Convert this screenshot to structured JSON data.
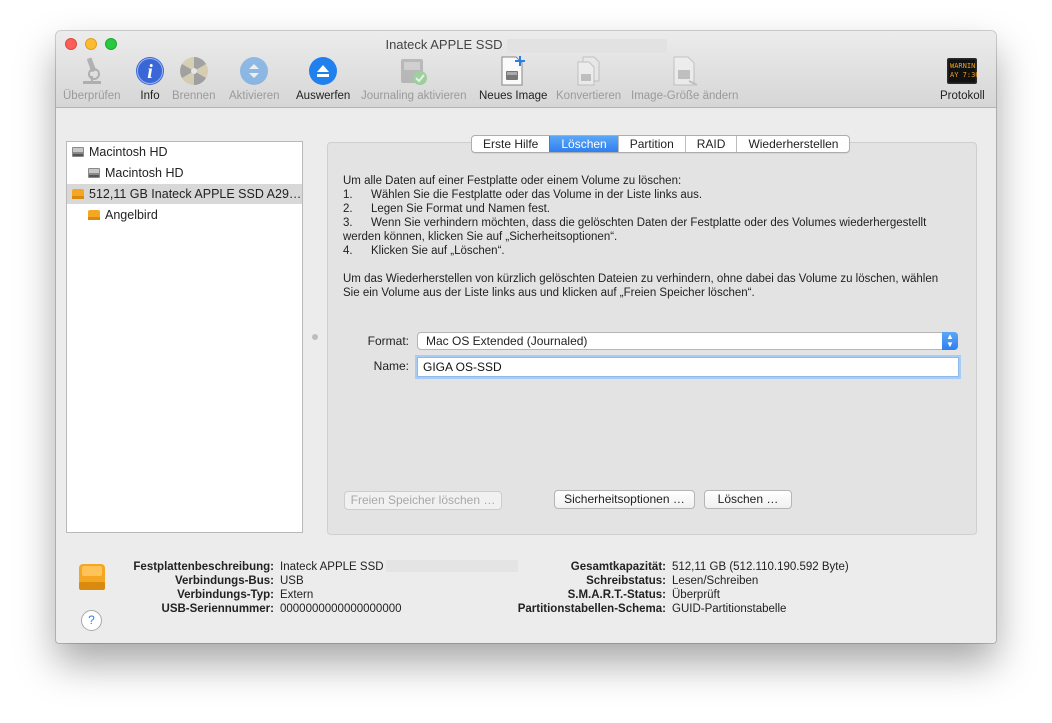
{
  "window": {
    "title": "Inateck APPLE SSD"
  },
  "toolbar": {
    "items": [
      {
        "label": "Überprüfen",
        "icon": "microscope-icon",
        "enabled": false
      },
      {
        "label": "Info",
        "icon": "info-icon",
        "enabled": true
      },
      {
        "label": "Brennen",
        "icon": "burn-disc-icon",
        "enabled": false
      },
      {
        "label": "Aktivieren",
        "icon": "mount-icon",
        "enabled": false
      },
      {
        "label": "Auswerfen",
        "icon": "eject-icon",
        "enabled": true
      },
      {
        "label": "Journaling aktivieren",
        "icon": "journaling-icon",
        "enabled": false
      },
      {
        "label": "Neues Image",
        "icon": "new-image-icon",
        "enabled": true
      },
      {
        "label": "Konvertieren",
        "icon": "convert-icon",
        "enabled": false
      },
      {
        "label": "Image-Größe ändern",
        "icon": "resize-image-icon",
        "enabled": false
      },
      {
        "label": "Protokoll",
        "icon": "log-console-icon",
        "enabled": true
      }
    ],
    "log_icon_text": "WARNIN\nAY 7:36"
  },
  "sidebar": {
    "items": [
      {
        "label": "Macintosh HD",
        "level": 0,
        "icon": "internal-disk-icon"
      },
      {
        "label": "Macintosh HD",
        "level": 1,
        "icon": "internal-disk-icon"
      },
      {
        "label": "512,11 GB Inateck APPLE SSD A29…",
        "level": 0,
        "icon": "external-disk-icon",
        "selected": true
      },
      {
        "label": "Angelbird",
        "level": 1,
        "icon": "external-disk-icon"
      }
    ]
  },
  "tabs": [
    "Erste Hilfe",
    "Löschen",
    "Partition",
    "RAID",
    "Wiederherstellen"
  ],
  "active_tab": "Löschen",
  "erase": {
    "intro": "Um alle Daten auf einer Festplatte oder einem Volume zu löschen:",
    "steps": [
      {
        "num": "1.",
        "text": "Wählen Sie die Festplatte oder das Volume in der Liste links aus."
      },
      {
        "num": "2.",
        "text": "Legen Sie Format und Namen fest."
      },
      {
        "num": "3.",
        "text": "Wenn Sie verhindern möchten, dass die gelöschten Daten der Festplatte oder des Volumes wiederhergestellt",
        "cont": "werden können, klicken Sie auf „Sicherheitsoptionen“."
      },
      {
        "num": "4.",
        "text": "Klicken Sie auf „Löschen“."
      }
    ],
    "para2_line1": "Um das Wiederherstellen von kürzlich gelöschten Dateien zu verhindern, ohne dabei das Volume zu löschen, wählen",
    "para2_line2": "Sie ein Volume aus der Liste links aus und klicken auf „Freien Speicher löschen“.",
    "format_label": "Format:",
    "format_value": "Mac OS Extended (Journaled)",
    "name_label": "Name:",
    "name_value": "GIGA OS-SSD",
    "free_space_button": "Freien Speicher löschen …",
    "security_button": "Sicherheitsoptionen …",
    "erase_button": "Löschen …"
  },
  "info": {
    "left": [
      {
        "key": "Festplattenbeschreibung",
        "value": "Inateck APPLE SSD"
      },
      {
        "key": "Verbindungs-Bus",
        "value": "USB"
      },
      {
        "key": "Verbindungs-Typ",
        "value": "Extern"
      },
      {
        "key": "USB-Seriennummer",
        "value": "0000000000000000000"
      }
    ],
    "right": [
      {
        "key": "Gesamtkapazität",
        "value": "512,11 GB (512.110.190.592 Byte)"
      },
      {
        "key": "Schreibstatus",
        "value": "Lesen/Schreiben"
      },
      {
        "key": "S.M.A.R.T.-Status",
        "value": "Überprüft"
      },
      {
        "key": "Partitionstabellen-Schema",
        "value": "GUID-Partitionstabelle"
      }
    ],
    "help_label": "?"
  },
  "colors": {
    "accent": "#2f7ff0",
    "disk_orange": "#f5a623"
  }
}
